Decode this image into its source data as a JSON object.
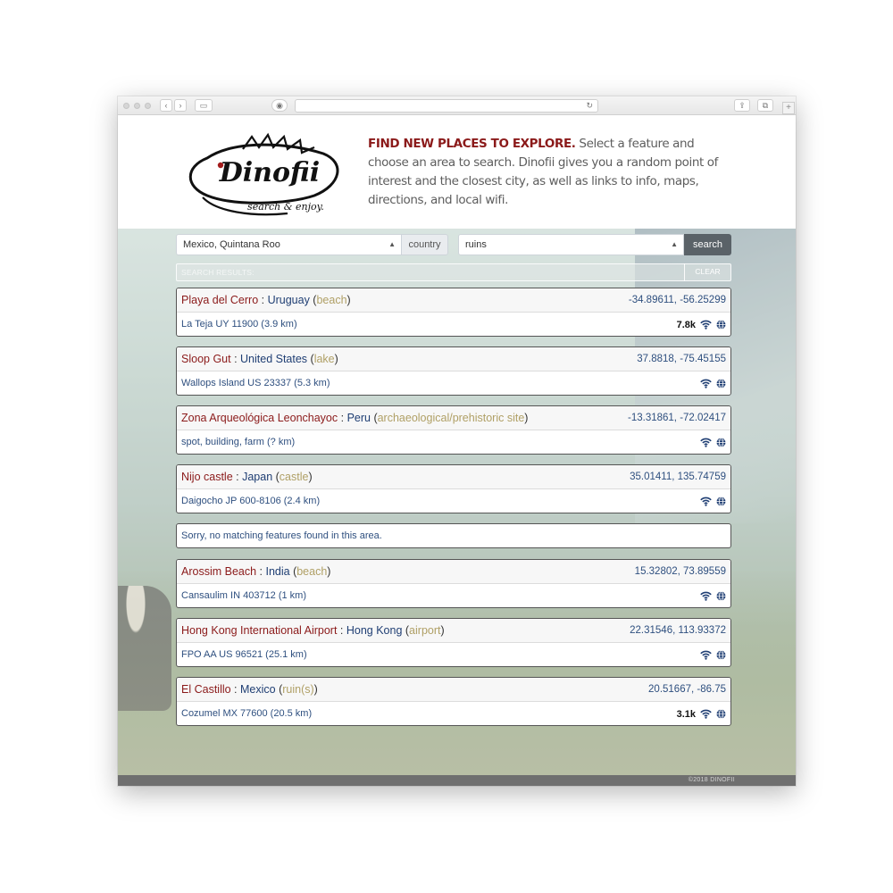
{
  "header": {
    "tagline_strong": "FIND NEW PLACES TO EXPLORE.",
    "tagline_rest": " Select a feature and choose an area to search. Dinofii gives you a random point of interest and the closest city, as well as links to info, maps, directions, and local wifi.",
    "logo_word": "Dinofii",
    "logo_sub": "search & enjoy."
  },
  "search": {
    "area_value": "Mexico, Quintana Roo",
    "area_addon": "country",
    "feature_value": "ruins",
    "button_label": "search"
  },
  "results_bar": {
    "label": "SEARCH RESULTS:",
    "clear_label": "CLEAR"
  },
  "results": [
    {
      "name": "Playa del Cerro",
      "country": "Uruguay",
      "type": "beach",
      "coords": "-34.89611, -56.25299",
      "city": "La Teja UY 11900 (3.9 km)",
      "pop": "7.8k"
    },
    {
      "name": "Sloop Gut",
      "country": "United States",
      "type": "lake",
      "coords": "37.8818, -75.45155",
      "city": "Wallops Island US 23337 (5.3 km)",
      "pop": ""
    },
    {
      "name": "Zona Arqueológica Leonchayoc",
      "country": "Peru",
      "type": "archaeological/prehistoric site",
      "coords": "-13.31861, -72.02417",
      "city": "spot, building, farm (? km)",
      "pop": ""
    },
    {
      "name": "Nijo castle",
      "country": "Japan",
      "type": "castle",
      "coords": "35.01411, 135.74759",
      "city": "Daigocho JP 600-8106 (2.4 km)",
      "pop": ""
    },
    {
      "name": "Arossim Beach",
      "country": "India",
      "type": "beach",
      "coords": "15.32802, 73.89559",
      "city": "Cansaulim IN 403712 (1 km)",
      "pop": ""
    },
    {
      "name": "Hong Kong International Airport",
      "country": "Hong Kong",
      "type": "airport",
      "coords": "22.31546, 113.93372",
      "city": "FPO AA US 96521 (25.1 km)",
      "pop": ""
    },
    {
      "name": "El Castillo",
      "country": "Mexico",
      "type": "ruin(s)",
      "coords": "20.51667, -86.75",
      "city": "Cozumel MX 77600 (20.5 km)",
      "pop": "3.1k"
    }
  ],
  "notice": "Sorry, no matching features found in this area.",
  "footer": {
    "copyright": "©2018 DINOFII"
  },
  "icons": {
    "wifi": "wifi-icon",
    "globe": "globe-icon"
  },
  "colors": {
    "name": "#8b1a1a",
    "country": "#1f3e73",
    "type": "#b0a066",
    "link": "#2e4f7f"
  }
}
